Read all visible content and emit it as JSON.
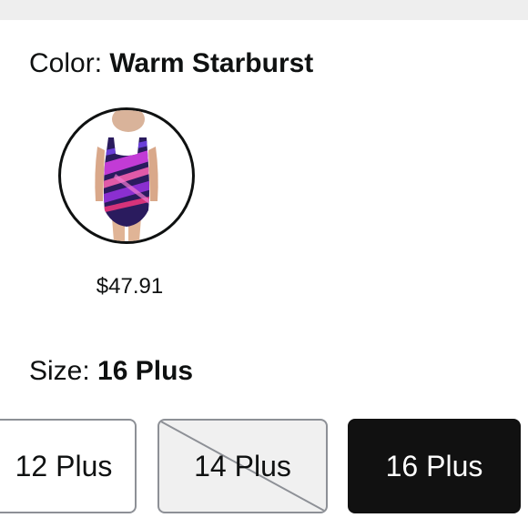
{
  "color": {
    "label": "Color: ",
    "selected": "Warm Starburst"
  },
  "swatches": [
    {
      "name": "Warm Starburst",
      "price": "$47.91",
      "selected": true
    }
  ],
  "size": {
    "label": "Size: ",
    "selected": "16 Plus",
    "options": [
      {
        "label": "12 Plus",
        "state": "available"
      },
      {
        "label": "14 Plus",
        "state": "unavailable"
      },
      {
        "label": "16 Plus",
        "state": "selected"
      }
    ]
  },
  "colors": {
    "text": "#0f1111",
    "selected_bg": "#111111",
    "unavailable_bg": "#f0f0f0",
    "border": "#8d9096",
    "swatch_primary": "#c23bd6",
    "swatch_secondary": "#3a1f8a"
  }
}
